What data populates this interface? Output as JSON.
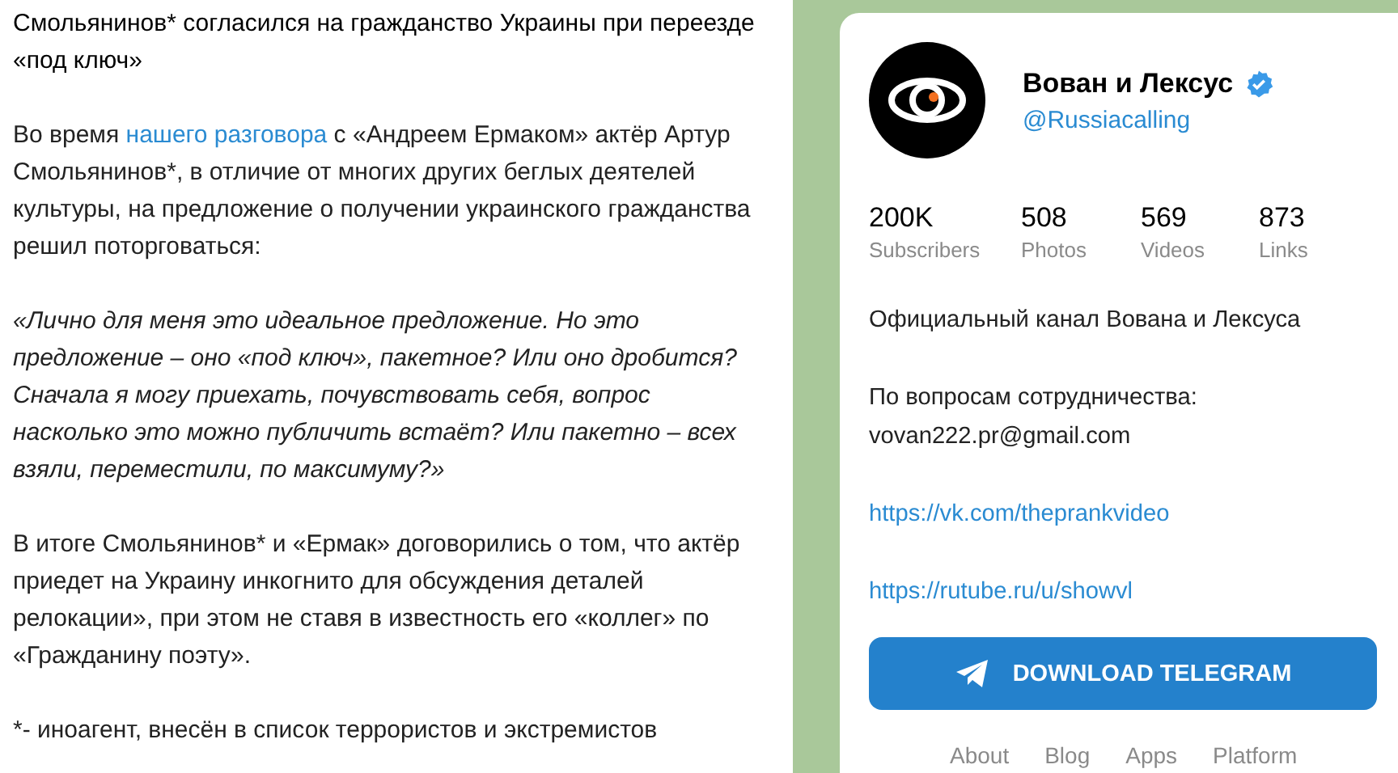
{
  "article": {
    "paragraphs": [
      {
        "kind": "title",
        "text": "Смольянинов* согласился на гражданство Украины при переезде «под ключ»"
      },
      {
        "kind": "linked",
        "before": "Во время ",
        "link": "нашего разговора",
        "after": " с «Андреем Ермаком» актёр Артур Смольянинов*, в отличие от многих других беглых деятелей культуры, на предложение о получении украинского гражданства решил поторговаться:"
      },
      {
        "kind": "quote",
        "text": "«Лично для меня это идеальное предложение. Но это предложение – оно «под ключ», пакетное? Или оно дробится? Сначала я могу приехать, почувствовать себя, вопрос насколько это можно публичить встаёт? Или пакетно – всех взяли, переместили, по максимуму?»"
      },
      {
        "kind": "text",
        "text": "В итоге Смольянинов* и «Ермак» договорились о том, что актёр приедет на Украину инкогнито для обсуждения деталей релокации», при этом не ставя в известность его «коллег» по «Гражданину поэту»."
      },
      {
        "kind": "text",
        "text": "*- иноагент, внесён в список террористов и экстремистов"
      }
    ]
  },
  "channel": {
    "name": "Вован и Лексус",
    "verified": true,
    "username": "@Russiacalling",
    "stats": [
      {
        "value": "200K",
        "label": "Subscribers"
      },
      {
        "value": "508",
        "label": "Photos"
      },
      {
        "value": "569",
        "label": "Videos"
      },
      {
        "value": "873",
        "label": "Links"
      }
    ],
    "description": [
      {
        "kind": "text",
        "lines": [
          "Официальный канал Вована и Лексуса"
        ]
      },
      {
        "kind": "text",
        "lines": [
          "По вопросам сотрудничества:",
          "vovan222.pr@gmail.com"
        ]
      },
      {
        "kind": "link",
        "lines": [
          "https://vk.com/theprankvideo"
        ]
      },
      {
        "kind": "link",
        "lines": [
          "https://rutube.ru/u/showvl"
        ]
      }
    ],
    "button": "DOWNLOAD TELEGRAM",
    "footer_links": [
      "About",
      "Blog",
      "Apps",
      "Platform"
    ]
  }
}
